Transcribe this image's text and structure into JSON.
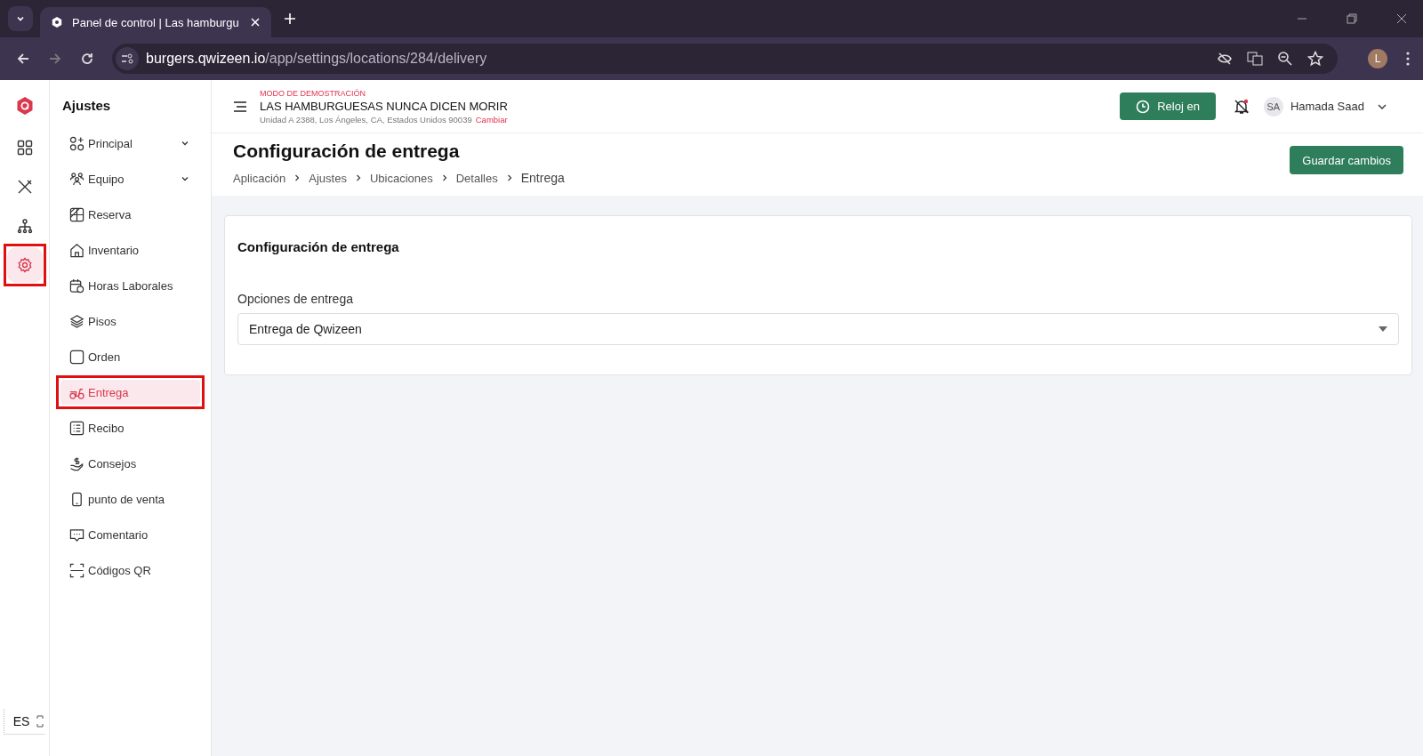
{
  "browser": {
    "tab_title": "Panel de control | Las hamburgu",
    "url_host": "burgers.qwizeen.io",
    "url_path": "/app/settings/locations/284/delivery",
    "profile_initial": "L"
  },
  "rail": {
    "items": [
      {
        "selected": false,
        "highlighted": false
      },
      {
        "selected": false,
        "highlighted": false
      },
      {
        "selected": false,
        "highlighted": false
      },
      {
        "selected": true,
        "highlighted": true
      }
    ],
    "language": "ES"
  },
  "sidebar": {
    "title": "Ajustes",
    "items": [
      {
        "label": "Principal",
        "expandable": true,
        "selected": false,
        "highlighted": false
      },
      {
        "label": "Equipo",
        "expandable": true,
        "selected": false,
        "highlighted": false
      },
      {
        "label": "Reserva",
        "expandable": false,
        "selected": false,
        "highlighted": false
      },
      {
        "label": "Inventario",
        "expandable": false,
        "selected": false,
        "highlighted": false
      },
      {
        "label": "Horas Laborales",
        "expandable": false,
        "selected": false,
        "highlighted": false
      },
      {
        "label": "Pisos",
        "expandable": false,
        "selected": false,
        "highlighted": false
      },
      {
        "label": "Orden",
        "expandable": false,
        "selected": false,
        "highlighted": false
      },
      {
        "label": "Entrega",
        "expandable": false,
        "selected": true,
        "highlighted": true
      },
      {
        "label": "Recibo",
        "expandable": false,
        "selected": false,
        "highlighted": false
      },
      {
        "label": "Consejos",
        "expandable": false,
        "selected": false,
        "highlighted": false
      },
      {
        "label": "punto de venta",
        "expandable": false,
        "selected": false,
        "highlighted": false
      },
      {
        "label": "Comentario",
        "expandable": false,
        "selected": false,
        "highlighted": false
      },
      {
        "label": "Códigos QR",
        "expandable": false,
        "selected": false,
        "highlighted": false
      }
    ]
  },
  "header": {
    "mode": "MODO DE DEMOSTRACIÓN",
    "restaurant": "LAS HAMBURGUESAS NUNCA DICEN MORIR",
    "address": "Unidad A 2388, Los Ángeles, CA, Estados Unidos 90039",
    "change_link": "Cambiar",
    "clock_button": "Reloj en",
    "user_initials": "SA",
    "user_name": "Hamada Saad"
  },
  "page": {
    "title": "Configuración de entrega",
    "breadcrumbs": [
      "Aplicación",
      "Ajustes",
      "Ubicaciones",
      "Detalles",
      "Entrega"
    ],
    "save_button": "Guardar cambios"
  },
  "card": {
    "title": "Configuración de entrega",
    "field_label": "Opciones de entrega",
    "field_value": "Entrega de Qwizeen"
  }
}
